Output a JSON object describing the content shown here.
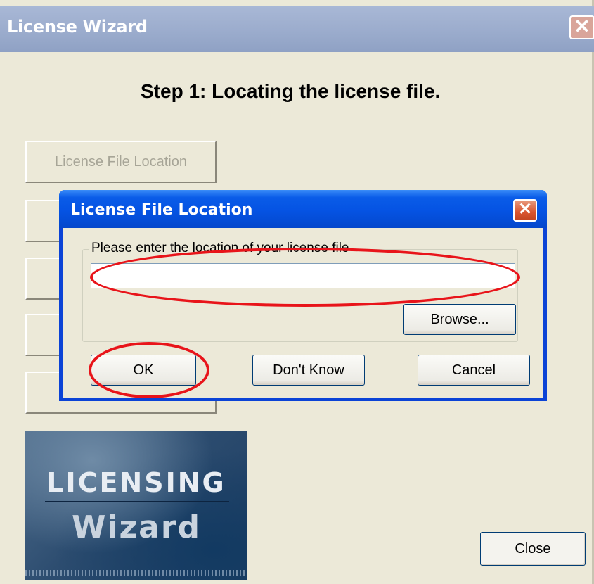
{
  "main_window": {
    "title": "License Wizard",
    "close_glyph": "✕",
    "step_title": "Step 1: Locating the license file.",
    "menu_buttons": [
      {
        "label": "License File Location"
      },
      {
        "label": ""
      },
      {
        "label": ""
      },
      {
        "label": ""
      },
      {
        "label": ""
      }
    ],
    "logo": {
      "line1": "LICENSING",
      "line2": "Wizard"
    },
    "close_button": "Close"
  },
  "dialog": {
    "title": "License File Location",
    "close_glyph": "✕",
    "group_label": "Please enter the location of your license file",
    "path_value": "",
    "browse_button": "Browse...",
    "ok_button": "OK",
    "dont_know_button": "Don't Know",
    "cancel_button": "Cancel"
  },
  "colors": {
    "dialog_titlebar": "#0553e3",
    "annotation": "#e8141a",
    "window_bg": "#ece9d8"
  }
}
